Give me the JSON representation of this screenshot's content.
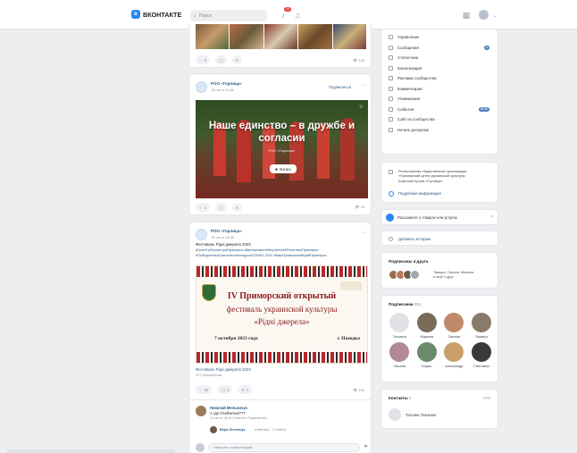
{
  "header": {
    "logo_letter": "в",
    "logo_text": "ВКОНТАКТЕ",
    "search_placeholder": "Поиск",
    "notif_count": "10"
  },
  "post0": {
    "likes": "5",
    "views": "133"
  },
  "post1": {
    "author": "РОО «Горлица»",
    "date": "13 окт в 14:46",
    "subscribe": "Подписаться",
    "cover_title": "Наше единство – в дружбе и согласии",
    "cover_sub": "РОО «Горлица»",
    "read_button": "Читать",
    "likes": "4",
    "views": "76"
  },
  "post2": {
    "author": "РОО «Горлица»",
    "date": "14 окт в 13:05",
    "text_line1": "Фестиваль Рідні джерела 2023",
    "tags_line1": "#ГрантГубернатораПриморья #ДепартаментВнутреннейПолитикиПриморья",
    "tags_line2": "#ПобедительиГрантовогоКонкурсаСОНКО-2022 #ВашПриморскийКрайПриморье",
    "banner_title": "IV Приморский открытый",
    "banner_line2": "фестиваль украинской культуры",
    "banner_line3": "«Рідні джерела»",
    "banner_date": "7 октября 2023 года",
    "banner_city": "г. Находка",
    "link_title": "Фестиваль Рідні джерела 2023",
    "link_sub": "217 просмотров",
    "likes": "33",
    "comments": "4",
    "reposts": "1",
    "views": "194"
  },
  "comment": {
    "author": "Николай Мельничук",
    "text": "А где Отабчитый???",
    "meta": "14 окт в 15:24  Ответить  Поделиться",
    "reply_author": "Вера Зеленчук",
    "reply_meta": "ответила · 2 ответа",
    "input_placeholder": "Написать комментарий..."
  },
  "menu": [
    {
      "label": "Управление",
      "badge": ""
    },
    {
      "label": "Сообщения",
      "badge": "●"
    },
    {
      "label": "Статистика",
      "badge": ""
    },
    {
      "label": "Монетизация",
      "badge": ""
    },
    {
      "label": "Реклама сообщества",
      "badge": ""
    },
    {
      "label": "Комментарии",
      "badge": ""
    },
    {
      "label": "Упоминания",
      "badge": ""
    },
    {
      "label": "События",
      "badge": "NEW"
    },
    {
      "label": "Сайт из сообщества",
      "badge": ""
    },
    {
      "label": "Начать репортаж",
      "badge": ""
    }
  ],
  "about": {
    "text1": "Региональная общественная организация",
    "text2": "«Приморский центр украинской культуры",
    "text3": "Анатолия Кроля «Горлица»",
    "more": "Подробная информация"
  },
  "promo": {
    "text": "Расскажите о товарах или услугах"
  },
  "add_story": {
    "text": "Добавить историю"
  },
  "friends": {
    "title": "Подписаны 4 друга",
    "names": "Тамара, Оксана, Марина",
    "more": "и ещё 1 друг"
  },
  "subscribers": {
    "title": "Подписчики",
    "count": "351",
    "people": [
      {
        "name": "Татьяна"
      },
      {
        "name": "Марина"
      },
      {
        "name": "Оксана"
      },
      {
        "name": "Тамара"
      },
      {
        "name": "Оксана"
      },
      {
        "name": "Борис"
      },
      {
        "name": "Александр"
      },
      {
        "name": "Светлана"
      }
    ]
  },
  "contacts": {
    "title": "Контакты",
    "count": "1",
    "right": "РРБ",
    "person": "Татьяна Ткаченко"
  },
  "colors": {
    "accent": "#2787f5",
    "bg": "#edeef0"
  }
}
